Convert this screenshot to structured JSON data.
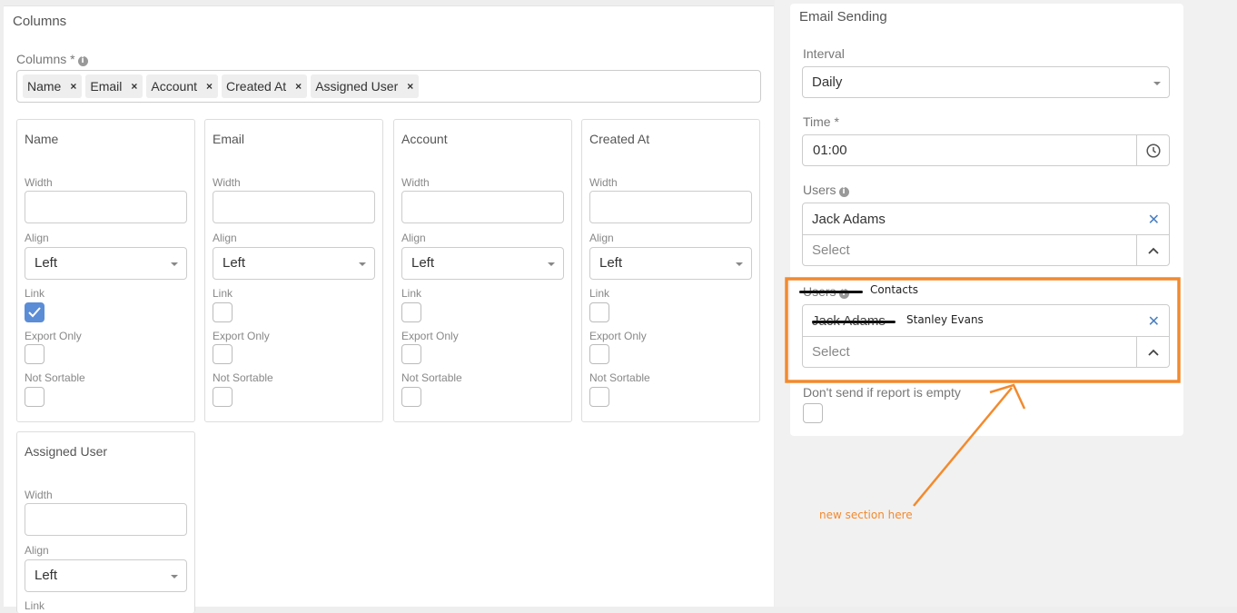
{
  "columns_panel": {
    "title": "Columns",
    "columns_label": "Columns *",
    "tags": [
      "Name",
      "Email",
      "Account",
      "Created At",
      "Assigned User"
    ],
    "remove_glyph": "×",
    "cards": [
      {
        "title": "Name",
        "width_label": "Width",
        "align_label": "Align",
        "align_value": "Left",
        "link_label": "Link",
        "link_checked": true,
        "export_label": "Export Only",
        "sortable_label": "Not Sortable"
      },
      {
        "title": "Email",
        "width_label": "Width",
        "align_label": "Align",
        "align_value": "Left",
        "link_label": "Link",
        "link_checked": false,
        "export_label": "Export Only",
        "sortable_label": "Not Sortable"
      },
      {
        "title": "Account",
        "width_label": "Width",
        "align_label": "Align",
        "align_value": "Left",
        "link_label": "Link",
        "link_checked": false,
        "export_label": "Export Only",
        "sortable_label": "Not Sortable"
      },
      {
        "title": "Created At",
        "width_label": "Width",
        "align_label": "Align",
        "align_value": "Left",
        "link_label": "Link",
        "link_checked": false,
        "export_label": "Export Only",
        "sortable_label": "Not Sortable"
      },
      {
        "title": "Assigned User",
        "width_label": "Width",
        "align_label": "Align",
        "align_value": "Left",
        "link_label": "Link"
      }
    ]
  },
  "email_sending": {
    "title": "Email Sending",
    "interval_label": "Interval",
    "interval_value": "Daily",
    "time_label": "Time *",
    "time_value": "01:00",
    "users_label": "Users",
    "users_value": "Jack Adams",
    "users_select_placeholder": "Select",
    "new_section": {
      "label_struck": "Users",
      "label_replacement": "Contacts",
      "value_struck": "Jack Adams",
      "value_replacement": "Stanley Evans",
      "select_placeholder": "Select"
    },
    "dont_send_label": "Don't send if report is empty"
  },
  "annotation": {
    "note": "new section here",
    "color": "#f28a2e"
  },
  "icons": [
    "info-icon",
    "clock-icon",
    "chevron-up-icon",
    "close-icon",
    "caret-down-icon",
    "checkmark-icon"
  ]
}
